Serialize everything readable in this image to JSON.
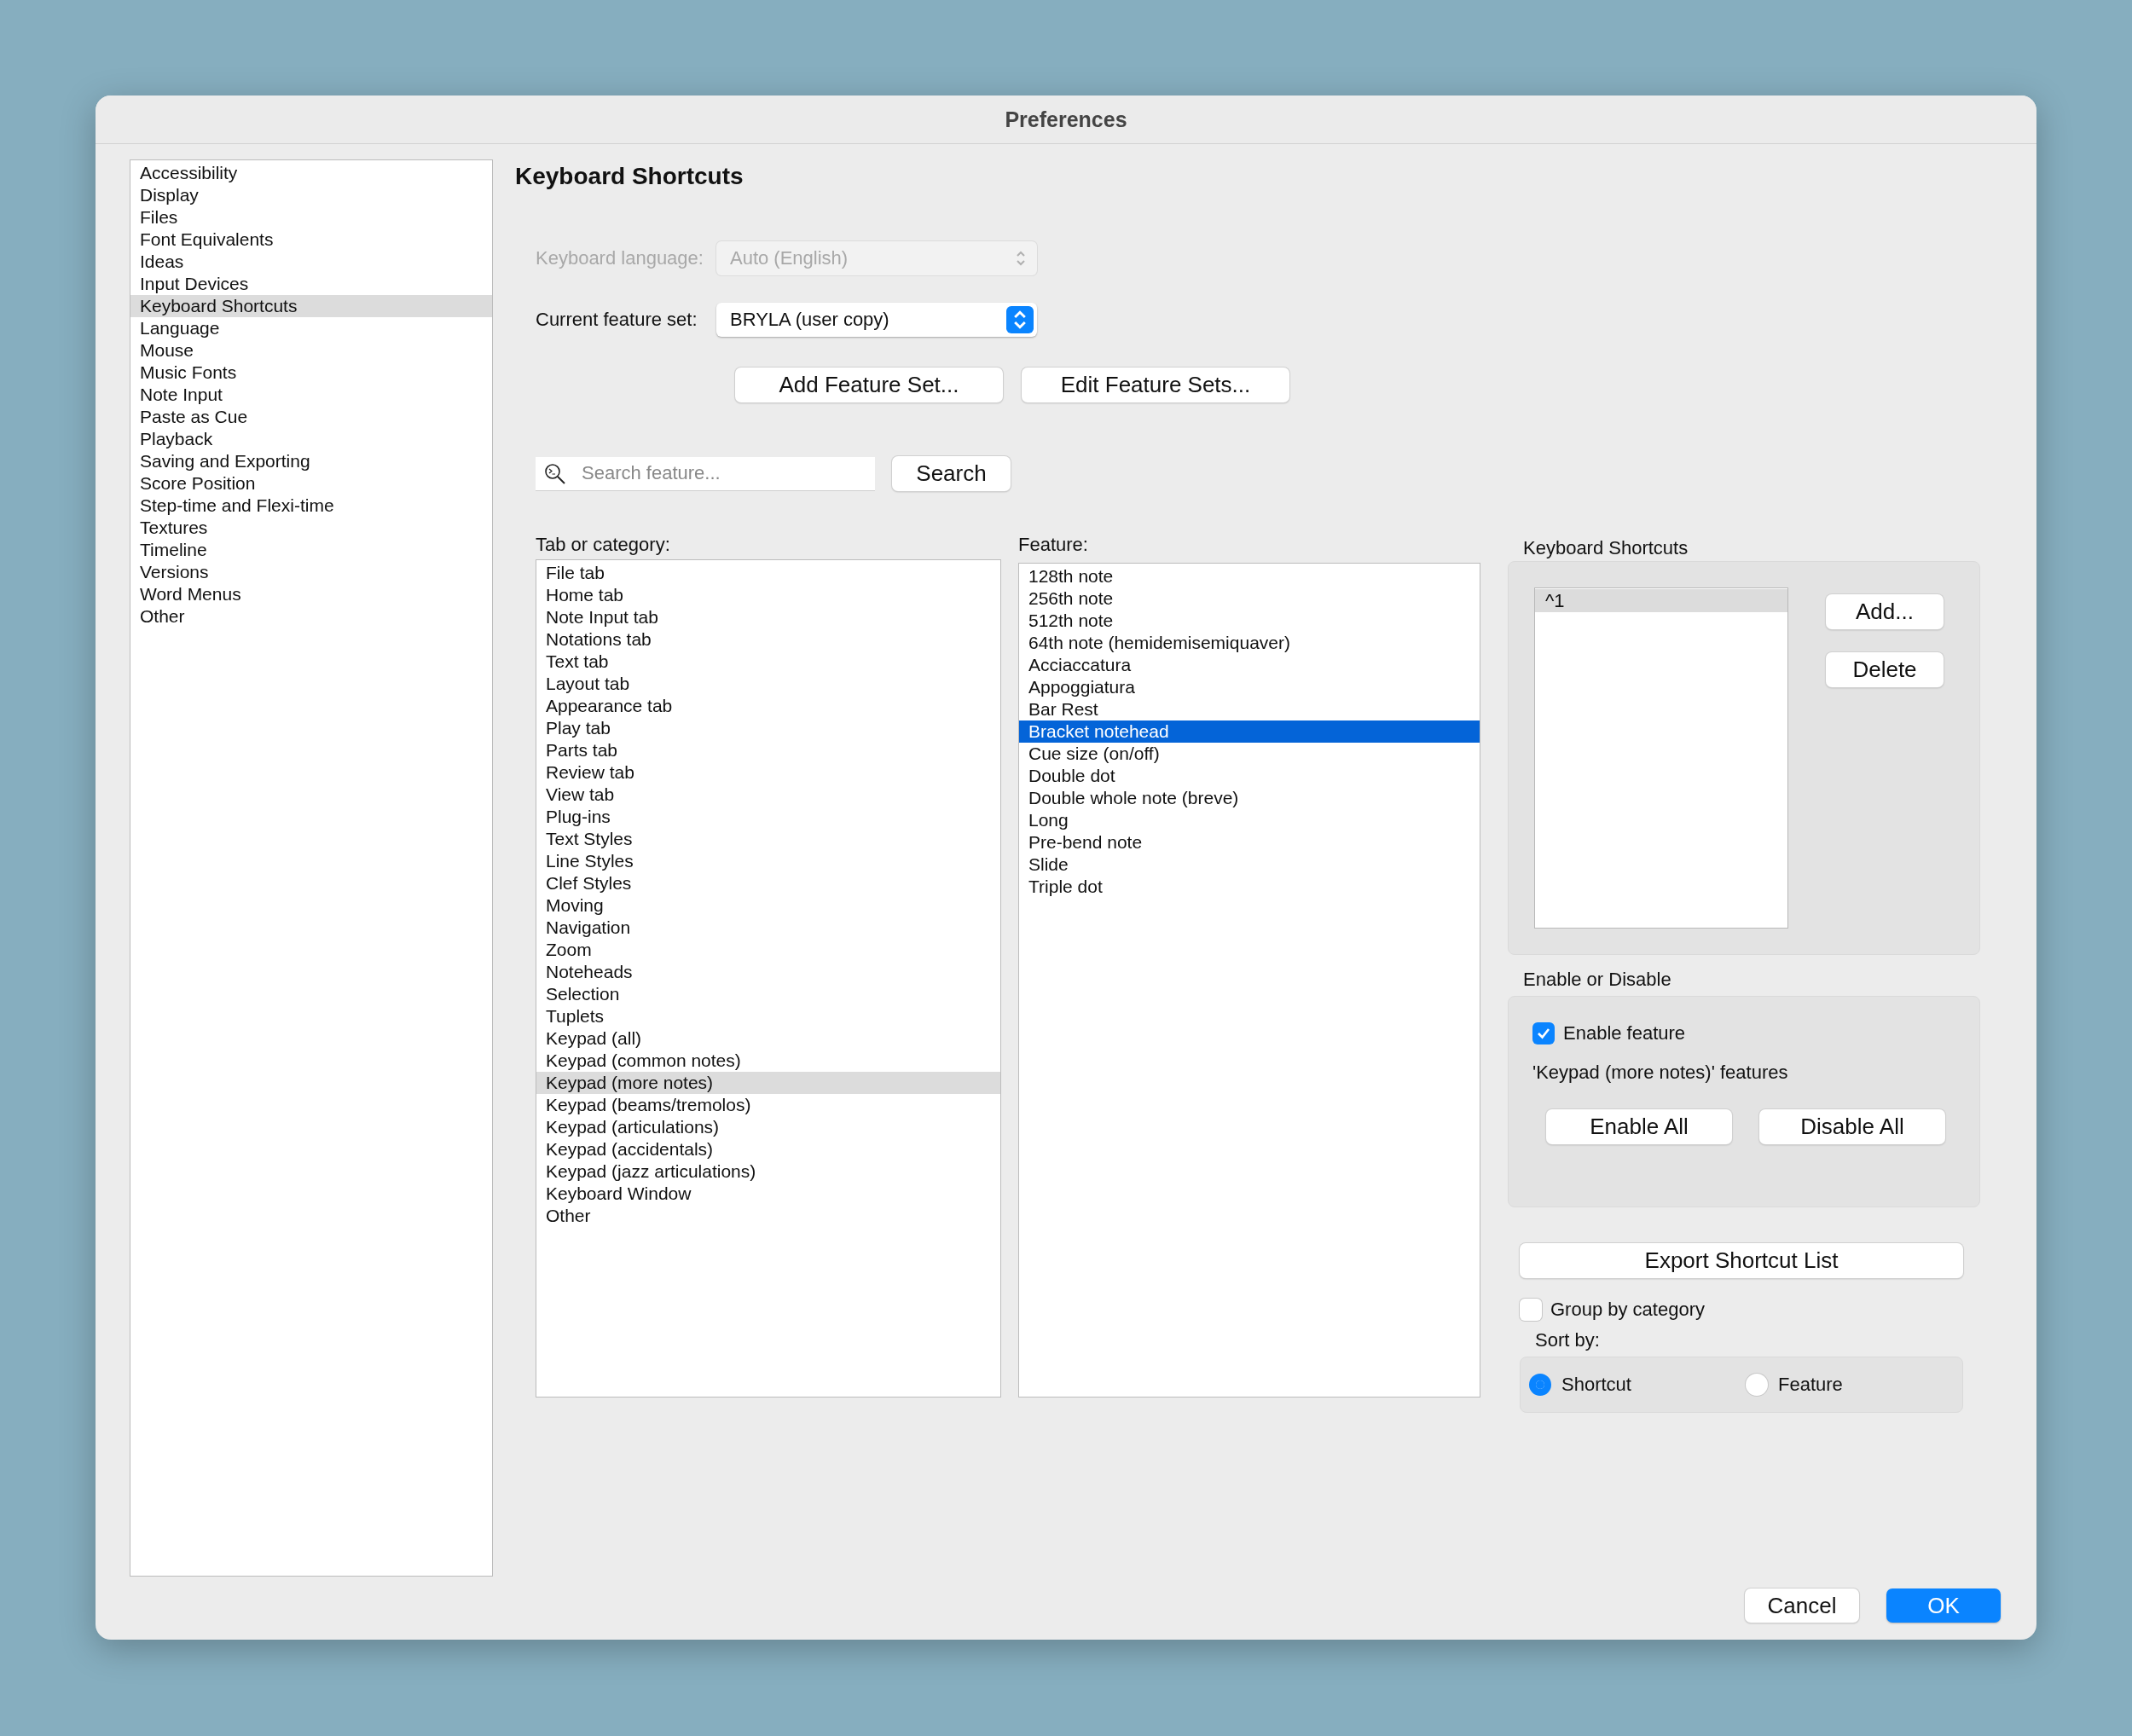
{
  "window": {
    "title": "Preferences"
  },
  "sidebar": {
    "items": [
      {
        "label": "Accessibility",
        "selected": false
      },
      {
        "label": "Display",
        "selected": false
      },
      {
        "label": "Files",
        "selected": false
      },
      {
        "label": "Font Equivalents",
        "selected": false
      },
      {
        "label": "Ideas",
        "selected": false
      },
      {
        "label": "Input Devices",
        "selected": false
      },
      {
        "label": "Keyboard Shortcuts",
        "selected": true
      },
      {
        "label": "Language",
        "selected": false
      },
      {
        "label": "Mouse",
        "selected": false
      },
      {
        "label": "Music Fonts",
        "selected": false
      },
      {
        "label": "Note Input",
        "selected": false
      },
      {
        "label": "Paste as Cue",
        "selected": false
      },
      {
        "label": "Playback",
        "selected": false
      },
      {
        "label": "Saving and Exporting",
        "selected": false
      },
      {
        "label": "Score Position",
        "selected": false
      },
      {
        "label": "Step-time and Flexi-time",
        "selected": false
      },
      {
        "label": "Textures",
        "selected": false
      },
      {
        "label": "Timeline",
        "selected": false
      },
      {
        "label": "Versions",
        "selected": false
      },
      {
        "label": "Word Menus",
        "selected": false
      },
      {
        "label": "Other",
        "selected": false
      }
    ]
  },
  "heading": "Keyboard Shortcuts",
  "keyboard_language": {
    "label": "Keyboard language:",
    "value": "Auto (English)",
    "disabled": true
  },
  "feature_set": {
    "label": "Current feature set:",
    "value": "BRYLA (user copy)",
    "disabled": false
  },
  "feature_set_buttons": [
    "Add Feature Set...",
    "Edit Feature Sets..."
  ],
  "search": {
    "placeholder": "Search feature...",
    "button": "Search"
  },
  "categories": {
    "label": "Tab or category:",
    "items": [
      {
        "label": "File tab",
        "selected": false
      },
      {
        "label": "Home tab",
        "selected": false
      },
      {
        "label": "Note Input tab",
        "selected": false
      },
      {
        "label": "Notations tab",
        "selected": false
      },
      {
        "label": "Text tab",
        "selected": false
      },
      {
        "label": "Layout tab",
        "selected": false
      },
      {
        "label": "Appearance tab",
        "selected": false
      },
      {
        "label": "Play tab",
        "selected": false
      },
      {
        "label": "Parts tab",
        "selected": false
      },
      {
        "label": "Review tab",
        "selected": false
      },
      {
        "label": "View tab",
        "selected": false
      },
      {
        "label": "Plug-ins",
        "selected": false
      },
      {
        "label": "Text Styles",
        "selected": false
      },
      {
        "label": "Line Styles",
        "selected": false
      },
      {
        "label": "Clef Styles",
        "selected": false
      },
      {
        "label": "Moving",
        "selected": false
      },
      {
        "label": "Navigation",
        "selected": false
      },
      {
        "label": "Zoom",
        "selected": false
      },
      {
        "label": "Noteheads",
        "selected": false
      },
      {
        "label": "Selection",
        "selected": false
      },
      {
        "label": "Tuplets",
        "selected": false
      },
      {
        "label": "Keypad (all)",
        "selected": false
      },
      {
        "label": "Keypad (common notes)",
        "selected": false
      },
      {
        "label": "Keypad (more notes)",
        "selected": true
      },
      {
        "label": "Keypad (beams/tremolos)",
        "selected": false
      },
      {
        "label": "Keypad (articulations)",
        "selected": false
      },
      {
        "label": "Keypad (accidentals)",
        "selected": false
      },
      {
        "label": "Keypad (jazz articulations)",
        "selected": false
      },
      {
        "label": "Keyboard Window",
        "selected": false
      },
      {
        "label": "Other",
        "selected": false
      }
    ]
  },
  "features": {
    "label": "Feature:",
    "items": [
      {
        "label": "128th note",
        "selected": false
      },
      {
        "label": "256th note",
        "selected": false
      },
      {
        "label": "512th note",
        "selected": false
      },
      {
        "label": "64th note (hemidemisemiquaver)",
        "selected": false
      },
      {
        "label": "Acciaccatura",
        "selected": false
      },
      {
        "label": "Appoggiatura",
        "selected": false
      },
      {
        "label": "Bar Rest",
        "selected": false
      },
      {
        "label": "Bracket notehead",
        "selected": true
      },
      {
        "label": "Cue size (on/off)",
        "selected": false
      },
      {
        "label": "Double dot",
        "selected": false
      },
      {
        "label": "Double whole note (breve)",
        "selected": false
      },
      {
        "label": "Long",
        "selected": false
      },
      {
        "label": "Pre-bend note",
        "selected": false
      },
      {
        "label": "Slide",
        "selected": false
      },
      {
        "label": "Triple dot",
        "selected": false
      }
    ]
  },
  "shortcuts": {
    "label": "Keyboard Shortcuts",
    "items": [
      {
        "label": "^1",
        "selected": true
      }
    ],
    "buttons": [
      "Add...",
      "Delete"
    ]
  },
  "enable": {
    "label": "Enable or Disable",
    "checkbox": {
      "label": "Enable feature",
      "checked": true
    },
    "note": "'Keypad (more notes)' features",
    "buttons": [
      "Enable All",
      "Disable All"
    ]
  },
  "export_button": "Export Shortcut List",
  "group_by": {
    "label": "Group by category",
    "checked": false
  },
  "sort_by": {
    "label": "Sort by:",
    "options": [
      {
        "label": "Shortcut",
        "selected": true
      },
      {
        "label": "Feature",
        "selected": false
      }
    ]
  },
  "footer_buttons": [
    {
      "label": "Cancel",
      "kind": "default"
    },
    {
      "label": "OK",
      "kind": "primary"
    }
  ]
}
